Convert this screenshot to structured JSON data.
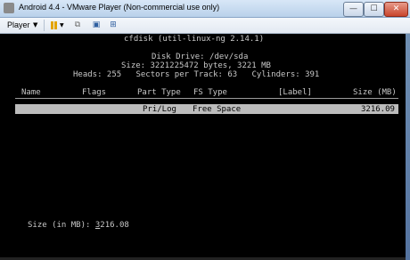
{
  "window": {
    "title": "Android 4.4 - VMware Player (Non-commercial use only)",
    "buttons": {
      "minimize": "—",
      "maximize": "☐",
      "close": "✕"
    }
  },
  "toolbar": {
    "player_menu": "Player",
    "player_arrow": "▼",
    "icons": [
      "pause-icon",
      "network-icon",
      "snapshot-icon",
      "unity-icon"
    ]
  },
  "console": {
    "program": "cfdisk (util-linux-ng 2.14.1)",
    "disk_drive": "Disk Drive: /dev/sda",
    "size_line": "Size: 3221225472 bytes, 3221 MB",
    "geometry_line": "Heads: 255   Sectors per Track: 63   Cylinders: 391",
    "columns": {
      "name": "Name",
      "flags": "Flags",
      "part_type": "Part Type",
      "fs_type": "FS Type",
      "label": "[Label]",
      "size": "Size (MB)"
    },
    "rows": [
      {
        "part_type": "Pri/Log",
        "fs_type": "Free Space",
        "size": "3216.09"
      }
    ],
    "prompt_label": "Size (in MB): ",
    "prompt_cursor_char": "3",
    "prompt_value_rest": "216.08"
  },
  "colors": {
    "console_bg": "#000000",
    "console_text": "#c8c8c8",
    "selection_bg": "#bcbcbc"
  }
}
